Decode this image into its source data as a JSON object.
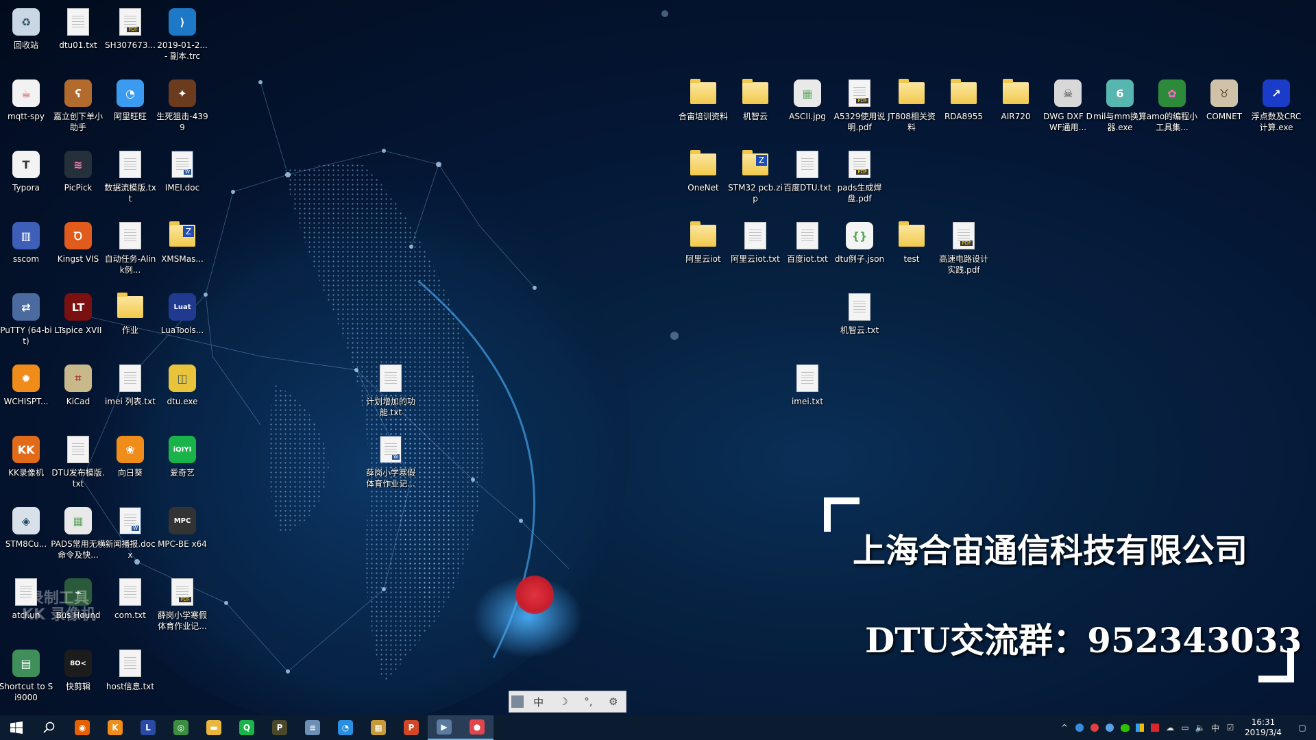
{
  "desktop_icons_left": [
    {
      "label": "回收站",
      "icon": "recycle-bin-icon"
    },
    {
      "label": "dtu01.txt",
      "icon": "text-file-icon"
    },
    {
      "label": "SH307673...",
      "icon": "pdf-file-icon"
    },
    {
      "label": "2019-01-2... - 副本.trc",
      "icon": "vscode-file-icon"
    },
    {
      "label": "mqtt-spy",
      "icon": "java-icon"
    },
    {
      "label": "嘉立创下单小助手",
      "icon": "bear-icon"
    },
    {
      "label": "阿里旺旺",
      "icon": "aliwangwang-icon"
    },
    {
      "label": "生死狙击-4399",
      "icon": "game-icon"
    },
    {
      "label": "Typora",
      "icon": "typora-icon"
    },
    {
      "label": "PicPick",
      "icon": "picpick-icon"
    },
    {
      "label": "数据流模版.txt",
      "icon": "text-file-icon"
    },
    {
      "label": "IMEI.doc",
      "icon": "word-file-icon"
    },
    {
      "label": "sscom",
      "icon": "sscom-icon"
    },
    {
      "label": "Kingst VIS",
      "icon": "kingst-icon"
    },
    {
      "label": "自动任务-Alink例...",
      "icon": "text-file-icon"
    },
    {
      "label": "XMSMas...",
      "icon": "zip-folder-icon"
    },
    {
      "label": "PuTTY (64-bit)",
      "icon": "putty-icon"
    },
    {
      "label": "LTspice XVII",
      "icon": "ltspice-icon"
    },
    {
      "label": "作业",
      "icon": "folder-icon"
    },
    {
      "label": "LuaTools...",
      "icon": "luat-icon"
    },
    {
      "label": "WCHISPT...",
      "icon": "gear-chip-icon"
    },
    {
      "label": "KiCad",
      "icon": "kicad-icon"
    },
    {
      "label": "imei 列表.txt",
      "icon": "text-file-icon"
    },
    {
      "label": "dtu.exe",
      "icon": "python-icon"
    },
    {
      "label": "KK录像机",
      "icon": "kk-recorder-icon"
    },
    {
      "label": "DTU发布模版.txt",
      "icon": "text-file-icon"
    },
    {
      "label": "向日葵",
      "icon": "sunflower-icon"
    },
    {
      "label": "爱奇艺",
      "icon": "iqiyi-icon"
    },
    {
      "label": "STM8Cu...",
      "icon": "stm8-icon"
    },
    {
      "label": "PADS常用无横命令及快...",
      "icon": "image-file-icon"
    },
    {
      "label": "新闻播报.docx",
      "icon": "word-file-icon"
    },
    {
      "label": "MPC-BE x64",
      "icon": "mpc-icon"
    },
    {
      "label": "atcl.un",
      "icon": "text-file-icon"
    },
    {
      "label": "Bus Hound",
      "icon": "bus-hound-icon"
    },
    {
      "label": "com.txt",
      "icon": "text-file-icon"
    },
    {
      "label": "薛岗小学寒假体育作业记...",
      "icon": "pdf-file-icon"
    },
    {
      "label": "Shortcut to Si9000",
      "icon": "si9000-icon"
    },
    {
      "label": "快剪辑",
      "icon": "kuaijianji-icon"
    },
    {
      "label": "host信息.txt",
      "icon": "text-file-icon"
    }
  ],
  "desktop_icons_middle": [
    {
      "label": "计划增加的功能.txt",
      "icon": "text-file-icon"
    },
    {
      "label": "薛岗小学寒假体育作业记...",
      "icon": "word-file-icon"
    }
  ],
  "desktop_icons_right": [
    {
      "label": "合宙培训资料",
      "icon": "folder-icon"
    },
    {
      "label": "机智云",
      "icon": "folder-icon"
    },
    {
      "label": "ASCII.jpg",
      "icon": "image-file-icon"
    },
    {
      "label": "A5329使用说明.pdf",
      "icon": "pdf-file-icon"
    },
    {
      "label": "JT808相关资料",
      "icon": "folder-icon"
    },
    {
      "label": "RDA8955",
      "icon": "folder-icon"
    },
    {
      "label": "AIR720",
      "icon": "folder-icon"
    },
    {
      "label": "DWG DXF DWF通用...",
      "icon": "skull-icon"
    },
    {
      "label": "mil与mm换算器.exe",
      "icon": "converter-icon"
    },
    {
      "label": "amo的编程小工具集...",
      "icon": "flower-icon"
    },
    {
      "label": "COMNET",
      "icon": "cow-icon"
    },
    {
      "label": "浮点数及CRC计算.exe",
      "icon": "chart-app-icon"
    },
    {
      "label": "OneNet",
      "icon": "folder-icon"
    },
    {
      "label": "STM32 pcb.zip",
      "icon": "zip-folder-icon"
    },
    {
      "label": "百度DTU.txt",
      "icon": "text-file-icon"
    },
    {
      "label": "pads生成焊盘.pdf",
      "icon": "pdf-file-icon"
    },
    {
      "label": "阿里云iot",
      "icon": "folder-icon"
    },
    {
      "label": "阿里云iot.txt",
      "icon": "text-file-icon"
    },
    {
      "label": "百度iot.txt",
      "icon": "text-file-icon"
    },
    {
      "label": "dtu例子.json",
      "icon": "json-file-icon"
    },
    {
      "label": "test",
      "icon": "folder-icon"
    },
    {
      "label": "高速电路设计实践.pdf",
      "icon": "pdf-file-icon"
    },
    {
      "label": "机智云.txt",
      "icon": "text-file-icon"
    },
    {
      "label": "imei.txt",
      "icon": "text-file-icon"
    }
  ],
  "banner": {
    "company": "上海合宙通信科技有限公司",
    "group": "DTU交流群：952343033"
  },
  "watermark": {
    "line1": "录制工具",
    "line2": "KK 录像机"
  },
  "ime_bar": {
    "items": [
      "中",
      "☽",
      "°,",
      "⚙"
    ]
  },
  "taskbar": {
    "start_icon": "windows-start-icon",
    "search_icon": "search-icon",
    "apps": [
      {
        "icon": "firefox-icon",
        "color": "#e66000",
        "glyph": "◉"
      },
      {
        "icon": "kk-recorder-icon",
        "color": "#f08c1a",
        "glyph": "K"
      },
      {
        "icon": "luat-icon",
        "color": "#2b4aa5",
        "glyph": "L"
      },
      {
        "icon": "chrome-icon",
        "color": "#3b8d3f",
        "glyph": "◎"
      },
      {
        "icon": "file-explorer-icon",
        "color": "#e9b640",
        "glyph": "▬"
      },
      {
        "icon": "iqiyi-icon",
        "color": "#19b34a",
        "glyph": "Q"
      },
      {
        "icon": "pdf-reader-icon",
        "color": "#4a4a2a",
        "glyph": "P"
      },
      {
        "icon": "notepad-icon",
        "color": "#6d8fb3",
        "glyph": "≡"
      },
      {
        "icon": "aliwangwang-icon",
        "color": "#2a8fe0",
        "glyph": "◔"
      },
      {
        "icon": "archive-icon",
        "color": "#c79a3a",
        "glyph": "▦"
      },
      {
        "icon": "powerpoint-icon",
        "color": "#d24726",
        "glyph": "P"
      },
      {
        "icon": "video-player-icon",
        "color": "#5a7ca0",
        "glyph": "▶"
      },
      {
        "icon": "screen-recorder-icon",
        "color": "#e2464d",
        "glyph": "●"
      }
    ],
    "tray": {
      "ime": "中",
      "time": "16:31",
      "date": "2019/3/4"
    }
  }
}
